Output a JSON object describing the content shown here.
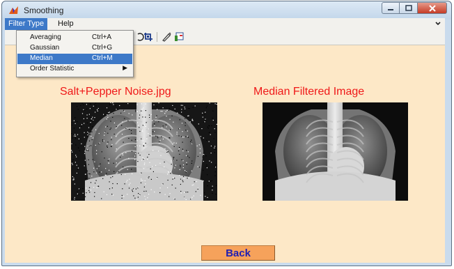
{
  "window": {
    "title": "Smoothing"
  },
  "menubar": {
    "items": [
      {
        "label": "Filter Type",
        "active": true
      },
      {
        "label": "Help",
        "active": false
      }
    ],
    "overflow_icon": "chevron-down-icon"
  },
  "toolbar": {
    "icons": [
      "rotate-icon",
      "crop-icon",
      "brush-icon",
      "insert-colorbar-icon"
    ]
  },
  "filter_menu": {
    "items": [
      {
        "label": "Averaging",
        "shortcut": "Ctrl+A",
        "highlighted": false
      },
      {
        "label": "Gaussian",
        "shortcut": "Ctrl+G",
        "highlighted": false
      },
      {
        "label": "Median",
        "shortcut": "Ctrl+M",
        "highlighted": true
      },
      {
        "label": "Order Statistic",
        "shortcut": "",
        "submenu": true,
        "highlighted": false
      }
    ]
  },
  "figure": {
    "left_image_title": "Salt+Pepper Noise.jpg",
    "right_image_title": "Median Filtered Image",
    "back_label": "Back"
  },
  "colors": {
    "canvas": "#fde8c7",
    "title_red": "#ef1818",
    "button": "#f6a25b",
    "button_text": "#1f1fb3",
    "menu_highlight": "#3d79c8"
  }
}
